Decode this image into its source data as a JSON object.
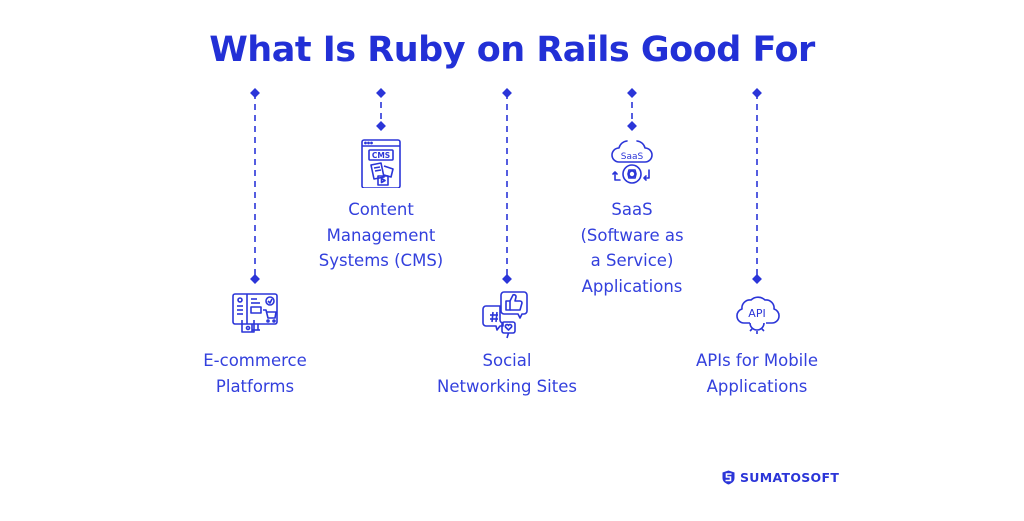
{
  "title": "What Is Ruby on Rails Good For",
  "accent_color": "#2b35d8",
  "items": [
    {
      "label_lines": [
        "E-commerce",
        "Platforms"
      ],
      "icon": "ecommerce-monitor-cart-icon"
    },
    {
      "label_lines": [
        "Content",
        "Management",
        "Systems (CMS)"
      ],
      "icon": "cms-window-icon",
      "icon_text": "CMS"
    },
    {
      "label_lines": [
        "Social",
        "Networking Sites"
      ],
      "icon": "social-chat-bubbles-icon"
    },
    {
      "label_lines": [
        "SaaS",
        "(Software as",
        "a Service)",
        "Applications"
      ],
      "icon": "saas-cloud-gear-icon",
      "icon_text": "SaaS"
    },
    {
      "label_lines": [
        "APIs for Mobile",
        "Applications"
      ],
      "icon": "api-cloud-gear-icon",
      "icon_text": "API"
    }
  ],
  "brand": {
    "name": "SUMATOSOFT",
    "icon": "sumatosoft-shield-icon"
  }
}
